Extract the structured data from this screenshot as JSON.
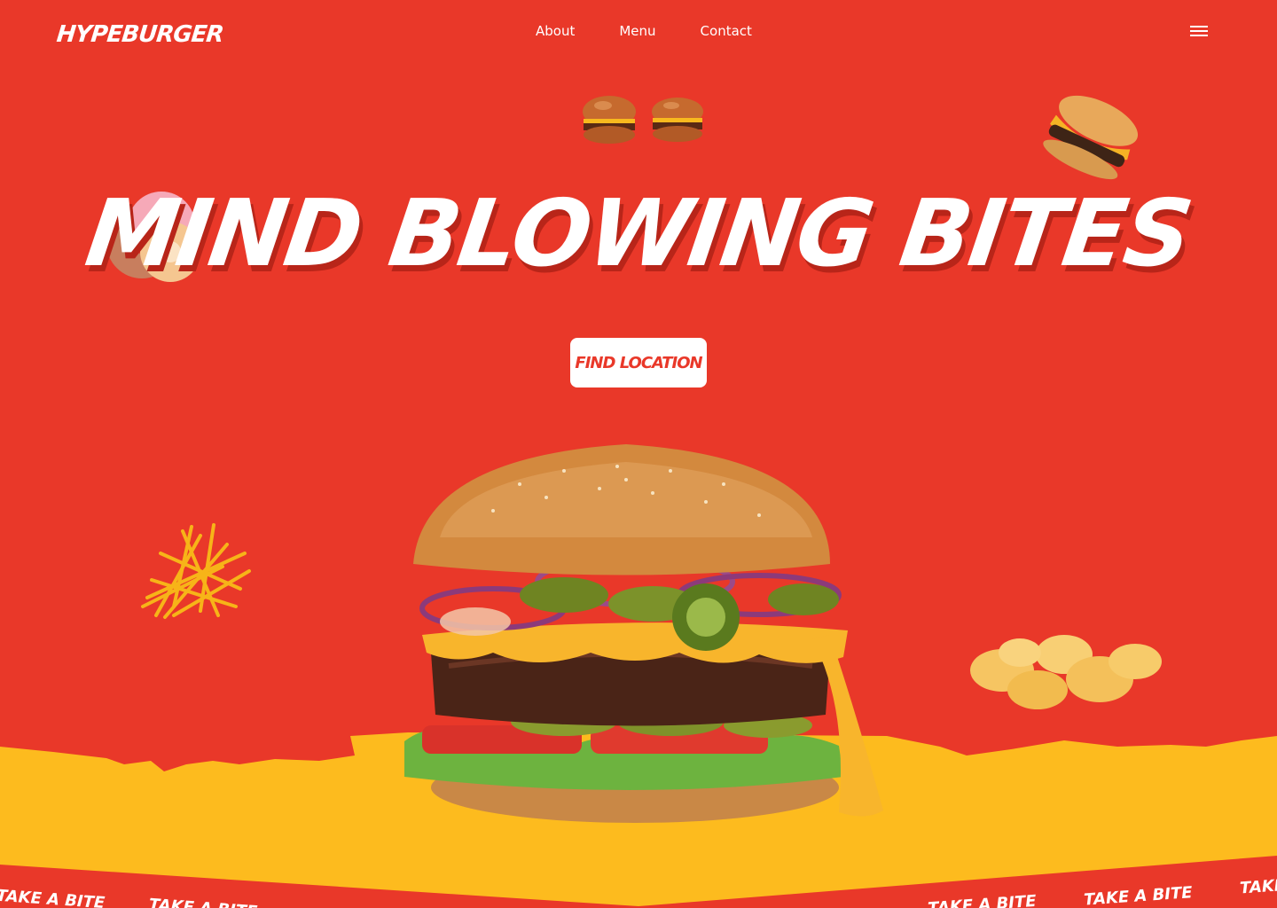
{
  "brand": {
    "logo": "HYPEBURGER"
  },
  "nav": {
    "items": [
      "About",
      "Menu",
      "Contact"
    ]
  },
  "hero": {
    "headline": "MIND BLOWING BITES",
    "cta_label": "FIND LOCATION"
  },
  "ticker": {
    "text": "TAKE A BITE"
  },
  "colors": {
    "background": "#E93829",
    "accent_yellow": "#FDBB1E",
    "text": "#FFFFFF"
  },
  "icons": {
    "menu": "hamburger-menu-icon"
  }
}
